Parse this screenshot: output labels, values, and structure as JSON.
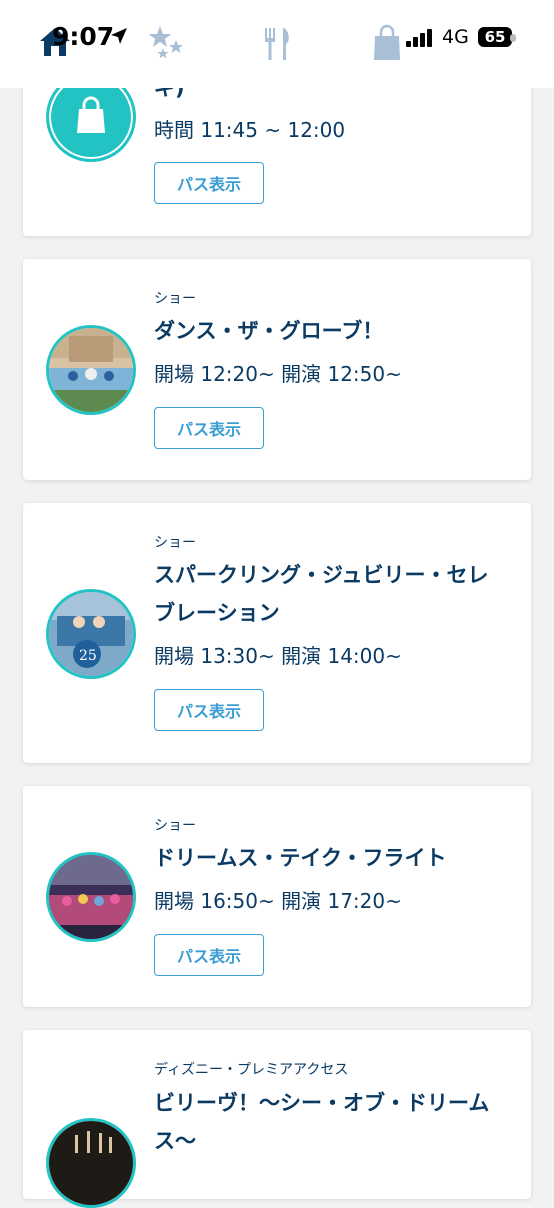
{
  "status": {
    "time": "9:07",
    "network": "4G",
    "battery": "65"
  },
  "nav": {
    "icons": [
      "home-icon",
      "stars-icon",
      "restaurant-icon",
      "shopping-bag-icon"
    ]
  },
  "colors": {
    "accent": "#3a9dd4",
    "ring": "#23c3c3",
    "text": "#0b3a63"
  },
  "cards": [
    {
      "title_partial": "ギ)",
      "time": "時間 11:45 ~ 12:00",
      "button": "パス表示"
    },
    {
      "category": "ショー",
      "title": "ダンス・ザ・グローブ！",
      "time": "開場 12:20~ 開演 12:50~",
      "button": "パス表示"
    },
    {
      "category": "ショー",
      "title_line1": "スパークリング・ジュビリー・セレ",
      "title_line2": "ブレーション",
      "time": "開場 13:30~ 開演 14:00~",
      "button": "パス表示"
    },
    {
      "category": "ショー",
      "title": "ドリームス・テイク・フライト",
      "time": "開場 16:50~ 開演 17:20~",
      "button": "パス表示"
    },
    {
      "category": "ディズニー・プレミアアクセス",
      "title_line1": "ビリーヴ！〜シー・オブ・ドリーム",
      "title_line2": "ス〜"
    }
  ]
}
